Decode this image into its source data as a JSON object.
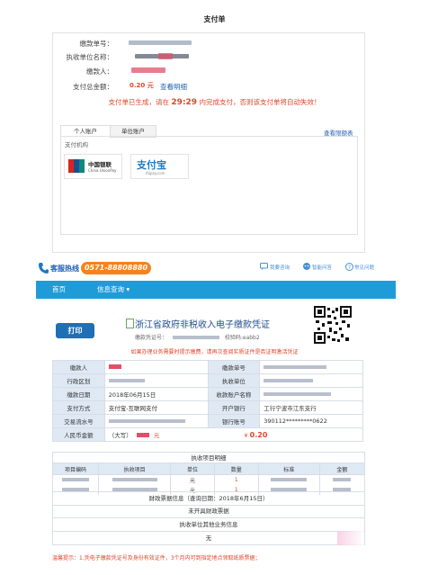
{
  "payment": {
    "title": "支付单",
    "fields": [
      {
        "label": "缴款单号："
      },
      {
        "label": "执收单位名称："
      },
      {
        "label": "缴款人："
      },
      {
        "label": "支付总金额："
      }
    ],
    "amount_value": "0.20",
    "amount_unit": "元",
    "view_detail": "查看明细",
    "countdown_prefix": "支付单已生成，请在",
    "countdown_time": "29:29",
    "countdown_suffix": "内完成支付，否则该支付单将自动失效！",
    "tabs": [
      {
        "label": "个人账户"
      },
      {
        "label": "单位账户"
      }
    ],
    "view_limit": "查看限额表",
    "channel_label": "支付机构",
    "providers": [
      {
        "name": "中国银联",
        "sub": "China UnionPay"
      },
      {
        "name": "支付宝",
        "sub": "Alipay.com"
      }
    ]
  },
  "header": {
    "hotline_label": "客服热线",
    "hotline_number": "0571-88808880",
    "links": [
      {
        "label": "我要咨询"
      },
      {
        "label": "智能问答"
      },
      {
        "label": "常见问题"
      }
    ],
    "nav": [
      {
        "label": "首页"
      },
      {
        "label": "信息查询"
      }
    ]
  },
  "voucher": {
    "print_label": "打印",
    "title": "浙江省政府非税收入电子缴款凭证",
    "voucher_no_label": "缴款凭证号：",
    "check_code_label": "校验码:eabb2",
    "warning": "如果办理业务需要时提示缴费，请再次查阅实质证件是否证明激活凭证",
    "rows": [
      {
        "l1": "缴款人",
        "v1": "",
        "l2": "缴款单号",
        "v2": ""
      },
      {
        "l1": "行政区划",
        "v1": "",
        "l2": "执收单位",
        "v2": ""
      },
      {
        "l1": "缴款日期",
        "v1": "2018年06月15日",
        "l2": "收款账户名称",
        "v2": ""
      },
      {
        "l1": "支付方式",
        "v1": "支付宝-互联网支付",
        "l2": "开户银行",
        "v2": "工行宁波市江东支行"
      },
      {
        "l1": "交易流水号",
        "v1": "",
        "l2": "银行账号",
        "v2": "390112*********0622"
      }
    ],
    "amount_label": "人民币金额",
    "amount_upper_prefix": "（大写）",
    "amount_upper_suffix": "元",
    "amount_symbol": "¥",
    "amount_number": "0.20",
    "detail_caption": "执收项目明细",
    "detail_headers": [
      "项目编码",
      "执收项目",
      "单位",
      "数量",
      "标准",
      "金额"
    ],
    "detail_rows": [
      {
        "unit": "元",
        "qty": "1"
      },
      {
        "unit": "元",
        "qty": "1"
      }
    ],
    "finance_info": "财政票据信息（查询日期：2018年6月15日）",
    "finance_status": "未开具财政票据",
    "unit_info": "执收单位其他业务信息",
    "unit_value": "无",
    "footer_tip": "温馨提示：1.凭电子缴款凭证号及身份有效证件，3个月内可到指定地点领取纸质票据；"
  },
  "colors": {
    "accent_blue": "#1f9cd8",
    "hotline_orange": "#f5821f",
    "alert_red": "#e0452b",
    "label_bg": "#dfe9f4"
  }
}
